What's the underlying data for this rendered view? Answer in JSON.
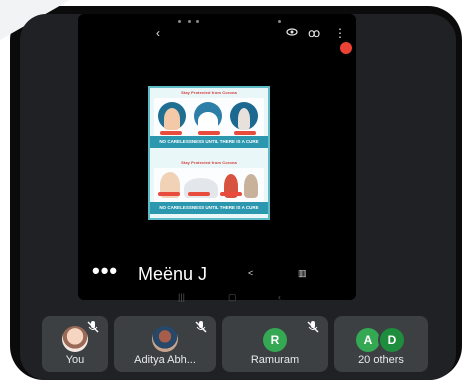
{
  "presenter": {
    "name": "Meënu J"
  },
  "poster": {
    "title_top": "Stay Protected from Corona",
    "title_bottom": "Stay Protected from Corona",
    "banner_top": "NO CARELESSNESS UNTIL THERE IS A CURE",
    "banner_bottom": "NO CARELESSNESS UNTIL THERE IS A CURE"
  },
  "participants": [
    {
      "label": "You",
      "muted": true,
      "avatar": "photo"
    },
    {
      "label": "Aditya Abh...",
      "muted": true,
      "avatar": "photo"
    },
    {
      "label": "Ramuram",
      "muted": true,
      "avatar_letter": "R",
      "avatar_color": "#34a853"
    },
    {
      "label": "20 others",
      "avatar_letters": [
        "A",
        "D"
      ],
      "avatar_colors": [
        "#34a853",
        "#1e8e3e"
      ]
    }
  ],
  "icons": {
    "back": "chevron-left-icon",
    "visibility": "eye-icon",
    "more_top": "more-vert-icon",
    "more_bottom": "more-horiz-icon",
    "share": "share-icon",
    "delete": "trash-icon"
  },
  "colors": {
    "background": "#202124",
    "tile": "#3c4043",
    "accent_green": "#34a853",
    "record_red": "#ea4335"
  }
}
